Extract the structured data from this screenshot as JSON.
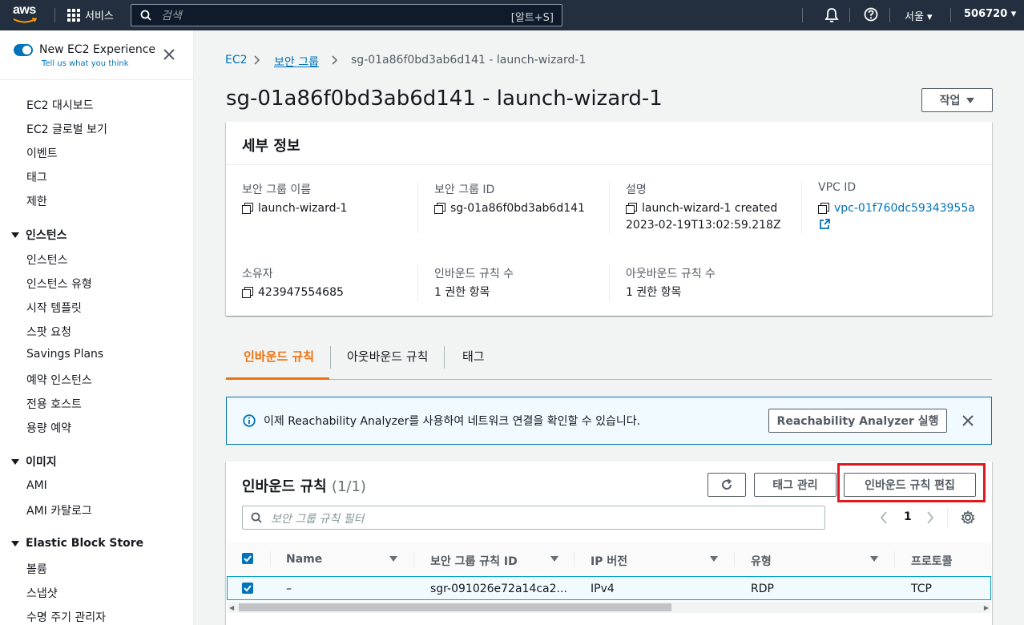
{
  "topbar": {
    "logo": "aws",
    "services_label": "서비스",
    "search_placeholder": "검색",
    "search_shortcut": "[알트+S]",
    "region": "서울",
    "account": "506720",
    "icons": [
      "grid-icon",
      "search-icon",
      "bell-icon",
      "help-icon"
    ]
  },
  "sidebar": {
    "new_experience_label": "New EC2 Experience",
    "tell_us": "Tell us what you think",
    "top_items": [
      "EC2 대시보드",
      "EC2 글로벌 보기",
      "이벤트",
      "태그",
      "제한"
    ],
    "sections": [
      {
        "title": "인스턴스",
        "items": [
          "인스턴스",
          "인스턴스 유형",
          "시작 템플릿",
          "스팟 요청",
          "Savings Plans",
          "예약 인스턴스",
          "전용 호스트",
          "용량 예약"
        ]
      },
      {
        "title": "이미지",
        "items": [
          "AMI",
          "AMI 카탈로그"
        ]
      },
      {
        "title": "Elastic Block Store",
        "items": [
          "볼륨",
          "스냅샷",
          "수명 주기 관리자"
        ]
      }
    ]
  },
  "breadcrumb": {
    "root": "EC2",
    "parent": "보안 그룹",
    "current": "sg-01a86f0bd3ab6d141 - launch-wizard-1"
  },
  "page_title": "sg-01a86f0bd3ab6d141 - launch-wizard-1",
  "actions_label": "작업",
  "details": {
    "header": "세부 정보",
    "sg_name_label": "보안 그룹 이름",
    "sg_name": "launch-wizard-1",
    "sg_id_label": "보안 그룹 ID",
    "sg_id": "sg-01a86f0bd3ab6d141",
    "desc_label": "설명",
    "desc_line1": "launch-wizard-1 created",
    "desc_line2": "2023-02-19T13:02:59.218Z",
    "vpc_label": "VPC ID",
    "vpc_id": "vpc-01f760dc59343955a",
    "owner_label": "소유자",
    "owner": "423947554685",
    "inbound_count_label": "인바운드 규칙 수",
    "inbound_count": "1 권한 항목",
    "outbound_count_label": "아웃바운드 규칙 수",
    "outbound_count": "1 권한 항목"
  },
  "tabs": [
    "인바운드 규칙",
    "아웃바운드 규칙",
    "태그"
  ],
  "info_banner": {
    "text": "이제 Reachability Analyzer를 사용하여 네트워크 연결을 확인할 수 있습니다.",
    "button": "Reachability Analyzer 실행"
  },
  "rules": {
    "title": "인바운드 규칙",
    "count": "(1/1)",
    "manage_tags": "태그 관리",
    "edit_rules": "인바운드 규칙 편집",
    "filter_placeholder": "보안 그룹 규칙 필터",
    "page": "1",
    "columns": [
      "Name",
      "보안 그룹 규칙 ID",
      "IP 버전",
      "유형",
      "프로토콜"
    ],
    "rows": [
      {
        "name": "–",
        "rule_id": "sgr-091026e72a14ca2...",
        "ip_version": "IPv4",
        "type": "RDP",
        "protocol": "TCP"
      }
    ]
  },
  "colors": {
    "accent": "#0073bb",
    "tab_active": "#ec7211",
    "highlight": "#e0191f",
    "topbar": "#232f3e"
  }
}
